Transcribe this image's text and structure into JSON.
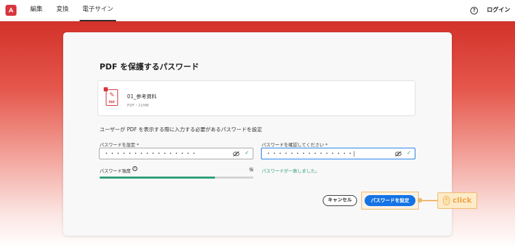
{
  "nav": {
    "items": [
      "編集",
      "変換",
      "電子サイン"
    ],
    "active": "電子サイン",
    "help_icon": "?",
    "login": "ログイン"
  },
  "dialog": {
    "title": "PDF を保護するパスワード",
    "file": {
      "name": "01_参考資料",
      "meta": "PDF・21MB",
      "icon": "pdf-file-icon",
      "icon_label": "PDF"
    },
    "instruction": "ユーザーが PDF を表示する際に入力する必要があるパスワードを設定",
    "password": {
      "label": "パスワードを設定 *",
      "value": "・・・・・・・・・・・・・・・・"
    },
    "confirm": {
      "label": "パスワードを確認してください *",
      "value": "・・・・・・・・・・・・・・・|"
    },
    "strength": {
      "label": "パスワード強度",
      "value_label": "強",
      "fraction": 0.75
    },
    "match_message": "パスワードが一致しました。",
    "cancel_label": "キャンセル",
    "submit_label": "パスワードを設定"
  },
  "annotation": {
    "text": "click",
    "color": "#f0b86e"
  },
  "colors": {
    "brand": "#d7373f",
    "primary": "#1473e6",
    "success": "#2d9d78"
  }
}
